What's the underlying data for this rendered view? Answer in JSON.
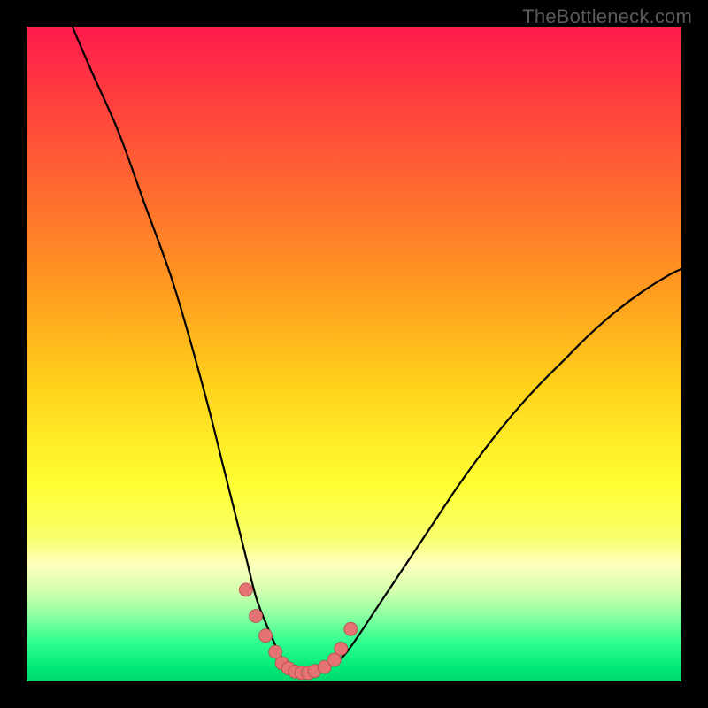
{
  "watermark": "TheBottleneck.com",
  "chart_data": {
    "type": "line",
    "title": "",
    "xlabel": "",
    "ylabel": "",
    "xlim": [
      0,
      100
    ],
    "ylim": [
      0,
      100
    ],
    "series": [
      {
        "name": "curve",
        "x": [
          7,
          10,
          14,
          18,
          22,
          25,
          28,
          30,
          32,
          33.5,
          35,
          36.5,
          38,
          39,
          40,
          41,
          42,
          43,
          44,
          46,
          48,
          50,
          54,
          58,
          62,
          66,
          70,
          74,
          78,
          82,
          86,
          90,
          94,
          98,
          100
        ],
        "y": [
          100,
          93,
          84,
          73,
          62,
          52,
          41,
          33,
          25,
          19,
          13,
          9,
          5.5,
          3.5,
          2,
          1.2,
          1,
          1.1,
          1.5,
          2.2,
          3.5,
          6,
          12,
          18,
          24,
          30,
          35.5,
          40.5,
          45,
          49,
          53,
          56.5,
          59.5,
          62,
          63
        ]
      }
    ],
    "markers": {
      "name": "highlight-points",
      "x": [
        33.5,
        35,
        36.5,
        38,
        39,
        40,
        41,
        42,
        43,
        44,
        45.5,
        47,
        48,
        49.5
      ],
      "y": [
        14,
        10,
        7,
        4.5,
        2.8,
        2,
        1.5,
        1.3,
        1.3,
        1.6,
        2.2,
        3.3,
        5,
        8
      ]
    },
    "background_gradient": {
      "stops": [
        {
          "pct": 0,
          "color": "#ff1a4d"
        },
        {
          "pct": 25,
          "color": "#ff6a30"
        },
        {
          "pct": 55,
          "color": "#ffd21a"
        },
        {
          "pct": 80,
          "color": "#ffff66"
        },
        {
          "pct": 92,
          "color": "#80ffa0"
        },
        {
          "pct": 100,
          "color": "#00d86f"
        }
      ]
    }
  }
}
